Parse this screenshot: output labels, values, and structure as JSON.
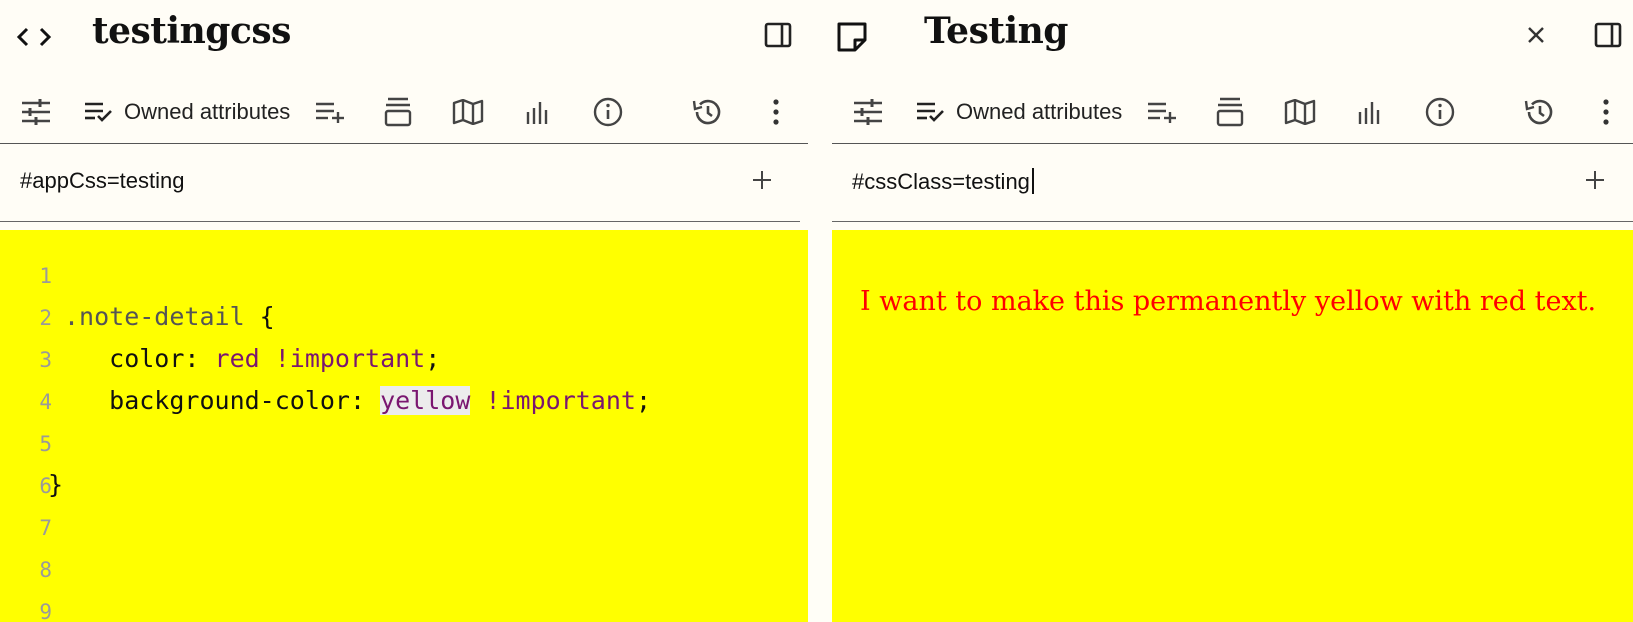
{
  "left_pane": {
    "title": "testingcss",
    "ribbon": {
      "owned_attributes_label": "Owned attributes"
    },
    "attribute_text": "#appCss=testing",
    "code_lines": [
      {
        "n": "1",
        "tokens": []
      },
      {
        "n": "2",
        "tokens": [
          {
            "t": "sel",
            "v": ".note-detail"
          },
          {
            "t": "plain",
            "v": " {"
          }
        ]
      },
      {
        "n": "3",
        "tokens": [
          {
            "t": "plain",
            "v": "   color: "
          },
          {
            "t": "val",
            "v": "red !important"
          },
          {
            "t": "plain",
            "v": ";"
          }
        ]
      },
      {
        "n": "4",
        "tokens": [
          {
            "t": "plain",
            "v": "   background-color: "
          },
          {
            "t": "hl",
            "v": "yellow"
          },
          {
            "t": "val",
            "v": " !important"
          },
          {
            "t": "plain",
            "v": ";"
          }
        ]
      },
      {
        "n": "5",
        "tokens": []
      },
      {
        "n": "6",
        "tokens": [
          {
            "t": "plain",
            "v": "}"
          }
        ]
      },
      {
        "n": "7",
        "tokens": []
      },
      {
        "n": "8",
        "tokens": []
      },
      {
        "n": "9",
        "tokens": []
      }
    ]
  },
  "right_pane": {
    "title": "Testing",
    "ribbon": {
      "owned_attributes_label": "Owned attributes"
    },
    "attribute_text": "#cssClass=testing",
    "note_text": "I want to make this permanently yellow with red text."
  },
  "colors": {
    "note_background": "#ffff00",
    "note_text": "#ff0000",
    "css_value": "#7a1670",
    "line_number": "#9a9a9a"
  }
}
